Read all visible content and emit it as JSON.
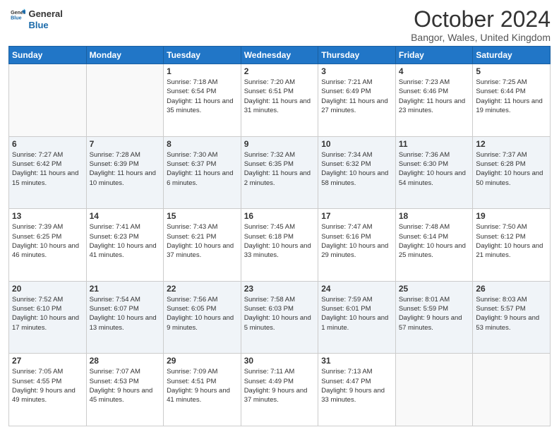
{
  "header": {
    "logo_line1": "General",
    "logo_line2": "Blue",
    "title": "October 2024",
    "location": "Bangor, Wales, United Kingdom"
  },
  "days_of_week": [
    "Sunday",
    "Monday",
    "Tuesday",
    "Wednesday",
    "Thursday",
    "Friday",
    "Saturday"
  ],
  "weeks": [
    [
      {
        "day": "",
        "sunrise": "",
        "sunset": "",
        "daylight": ""
      },
      {
        "day": "",
        "sunrise": "",
        "sunset": "",
        "daylight": ""
      },
      {
        "day": "1",
        "sunrise": "Sunrise: 7:18 AM",
        "sunset": "Sunset: 6:54 PM",
        "daylight": "Daylight: 11 hours and 35 minutes."
      },
      {
        "day": "2",
        "sunrise": "Sunrise: 7:20 AM",
        "sunset": "Sunset: 6:51 PM",
        "daylight": "Daylight: 11 hours and 31 minutes."
      },
      {
        "day": "3",
        "sunrise": "Sunrise: 7:21 AM",
        "sunset": "Sunset: 6:49 PM",
        "daylight": "Daylight: 11 hours and 27 minutes."
      },
      {
        "day": "4",
        "sunrise": "Sunrise: 7:23 AM",
        "sunset": "Sunset: 6:46 PM",
        "daylight": "Daylight: 11 hours and 23 minutes."
      },
      {
        "day": "5",
        "sunrise": "Sunrise: 7:25 AM",
        "sunset": "Sunset: 6:44 PM",
        "daylight": "Daylight: 11 hours and 19 minutes."
      }
    ],
    [
      {
        "day": "6",
        "sunrise": "Sunrise: 7:27 AM",
        "sunset": "Sunset: 6:42 PM",
        "daylight": "Daylight: 11 hours and 15 minutes."
      },
      {
        "day": "7",
        "sunrise": "Sunrise: 7:28 AM",
        "sunset": "Sunset: 6:39 PM",
        "daylight": "Daylight: 11 hours and 10 minutes."
      },
      {
        "day": "8",
        "sunrise": "Sunrise: 7:30 AM",
        "sunset": "Sunset: 6:37 PM",
        "daylight": "Daylight: 11 hours and 6 minutes."
      },
      {
        "day": "9",
        "sunrise": "Sunrise: 7:32 AM",
        "sunset": "Sunset: 6:35 PM",
        "daylight": "Daylight: 11 hours and 2 minutes."
      },
      {
        "day": "10",
        "sunrise": "Sunrise: 7:34 AM",
        "sunset": "Sunset: 6:32 PM",
        "daylight": "Daylight: 10 hours and 58 minutes."
      },
      {
        "day": "11",
        "sunrise": "Sunrise: 7:36 AM",
        "sunset": "Sunset: 6:30 PM",
        "daylight": "Daylight: 10 hours and 54 minutes."
      },
      {
        "day": "12",
        "sunrise": "Sunrise: 7:37 AM",
        "sunset": "Sunset: 6:28 PM",
        "daylight": "Daylight: 10 hours and 50 minutes."
      }
    ],
    [
      {
        "day": "13",
        "sunrise": "Sunrise: 7:39 AM",
        "sunset": "Sunset: 6:25 PM",
        "daylight": "Daylight: 10 hours and 46 minutes."
      },
      {
        "day": "14",
        "sunrise": "Sunrise: 7:41 AM",
        "sunset": "Sunset: 6:23 PM",
        "daylight": "Daylight: 10 hours and 41 minutes."
      },
      {
        "day": "15",
        "sunrise": "Sunrise: 7:43 AM",
        "sunset": "Sunset: 6:21 PM",
        "daylight": "Daylight: 10 hours and 37 minutes."
      },
      {
        "day": "16",
        "sunrise": "Sunrise: 7:45 AM",
        "sunset": "Sunset: 6:18 PM",
        "daylight": "Daylight: 10 hours and 33 minutes."
      },
      {
        "day": "17",
        "sunrise": "Sunrise: 7:47 AM",
        "sunset": "Sunset: 6:16 PM",
        "daylight": "Daylight: 10 hours and 29 minutes."
      },
      {
        "day": "18",
        "sunrise": "Sunrise: 7:48 AM",
        "sunset": "Sunset: 6:14 PM",
        "daylight": "Daylight: 10 hours and 25 minutes."
      },
      {
        "day": "19",
        "sunrise": "Sunrise: 7:50 AM",
        "sunset": "Sunset: 6:12 PM",
        "daylight": "Daylight: 10 hours and 21 minutes."
      }
    ],
    [
      {
        "day": "20",
        "sunrise": "Sunrise: 7:52 AM",
        "sunset": "Sunset: 6:10 PM",
        "daylight": "Daylight: 10 hours and 17 minutes."
      },
      {
        "day": "21",
        "sunrise": "Sunrise: 7:54 AM",
        "sunset": "Sunset: 6:07 PM",
        "daylight": "Daylight: 10 hours and 13 minutes."
      },
      {
        "day": "22",
        "sunrise": "Sunrise: 7:56 AM",
        "sunset": "Sunset: 6:05 PM",
        "daylight": "Daylight: 10 hours and 9 minutes."
      },
      {
        "day": "23",
        "sunrise": "Sunrise: 7:58 AM",
        "sunset": "Sunset: 6:03 PM",
        "daylight": "Daylight: 10 hours and 5 minutes."
      },
      {
        "day": "24",
        "sunrise": "Sunrise: 7:59 AM",
        "sunset": "Sunset: 6:01 PM",
        "daylight": "Daylight: 10 hours and 1 minute."
      },
      {
        "day": "25",
        "sunrise": "Sunrise: 8:01 AM",
        "sunset": "Sunset: 5:59 PM",
        "daylight": "Daylight: 9 hours and 57 minutes."
      },
      {
        "day": "26",
        "sunrise": "Sunrise: 8:03 AM",
        "sunset": "Sunset: 5:57 PM",
        "daylight": "Daylight: 9 hours and 53 minutes."
      }
    ],
    [
      {
        "day": "27",
        "sunrise": "Sunrise: 7:05 AM",
        "sunset": "Sunset: 4:55 PM",
        "daylight": "Daylight: 9 hours and 49 minutes."
      },
      {
        "day": "28",
        "sunrise": "Sunrise: 7:07 AM",
        "sunset": "Sunset: 4:53 PM",
        "daylight": "Daylight: 9 hours and 45 minutes."
      },
      {
        "day": "29",
        "sunrise": "Sunrise: 7:09 AM",
        "sunset": "Sunset: 4:51 PM",
        "daylight": "Daylight: 9 hours and 41 minutes."
      },
      {
        "day": "30",
        "sunrise": "Sunrise: 7:11 AM",
        "sunset": "Sunset: 4:49 PM",
        "daylight": "Daylight: 9 hours and 37 minutes."
      },
      {
        "day": "31",
        "sunrise": "Sunrise: 7:13 AM",
        "sunset": "Sunset: 4:47 PM",
        "daylight": "Daylight: 9 hours and 33 minutes."
      },
      {
        "day": "",
        "sunrise": "",
        "sunset": "",
        "daylight": ""
      },
      {
        "day": "",
        "sunrise": "",
        "sunset": "",
        "daylight": ""
      }
    ]
  ]
}
